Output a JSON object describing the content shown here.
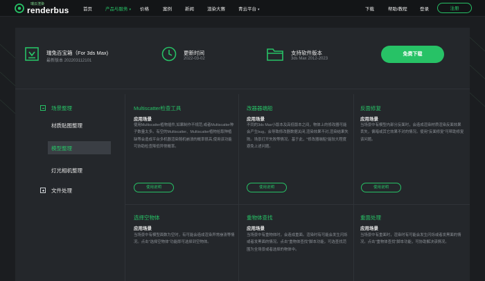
{
  "nav": {
    "logo_sub": "瑞云渲染",
    "logo_main": "renderbus",
    "items": [
      {
        "label": "首页"
      },
      {
        "label": "产品与服务"
      },
      {
        "label": "价格"
      },
      {
        "label": "案例"
      },
      {
        "label": "新闻"
      },
      {
        "label": "渲染大赛"
      },
      {
        "label": "青云平台"
      }
    ],
    "right": {
      "download": "下载",
      "help": "帮助/教程",
      "login": "登录",
      "register": "注册"
    }
  },
  "header": {
    "product": {
      "title": "瑞兔百宝箱（For 3ds Max)",
      "sub": "最新版本  202203112101"
    },
    "update": {
      "title": "更新时间",
      "sub": "2022-03-02"
    },
    "support": {
      "title": "支持软件版本",
      "sub": "3ds Max 2012-2023"
    },
    "download_button": "免费下载"
  },
  "sidebar": {
    "scene": "场景整理",
    "material": "材质贴图整理",
    "model": "模型整理",
    "light": "灯光相机整理",
    "file": "文件处理"
  },
  "cards": [
    {
      "title": "Multiscatter检查工具",
      "sub": "应用场景",
      "desc": "使用Multiscatter植物插件,如果制作不规范,或者Multiscatter种子数量太多。有空的Multiscatter、Multiscatter植物拾取种植缺等会造成平台多机器渲染随机崩溃的概率很高,使用该功能可协助检查降低异常概率。",
      "button": "使用说明"
    },
    {
      "title": "改器器端船",
      "sub": "应用场景",
      "desc": "不同的3ds Max小版本及高低版本之间，物体上的修改器可能会产生bug，会导致修改器数据关闭,渲染效果不对,渲染结果失败。场景打开失败等情况。基于此，\"修改器端船\"能较大程度避免上述问题。",
      "button": "使用说明"
    },
    {
      "title": "反面修复",
      "sub": "应用场景",
      "desc": "当场景中有模型内部分反面时，会造成渲染材质渲染反面效果丢失，偏暗或其它效果不对的情况。使用\"反面修复\"可帮助修复该问题。",
      "button": "使用说明"
    },
    {
      "title": "选择空物体",
      "sub": "应用场景",
      "desc": "当场景中有模型面数为空时，有可能会造成渲染异常崩溃等情况。点击\"选择空物体\"功能即可选择到空物体。"
    },
    {
      "title": "重物体查找",
      "sub": "应用场景",
      "desc": "当场景中有重物体时，会造成重面。渲染时有可能会发生闪烁或者发黑面的情况。点击\"重物体查找\"脚本功能，可选查找范围为全场景或者选择的物体中。"
    },
    {
      "title": "重面处理",
      "sub": "应用场景",
      "desc": "当场景中有重面时，渲染时有可能会发生闪烁或者发黑面的情况。点击\"重物体查找\"脚本功能，可协助解决该情况。"
    }
  ]
}
